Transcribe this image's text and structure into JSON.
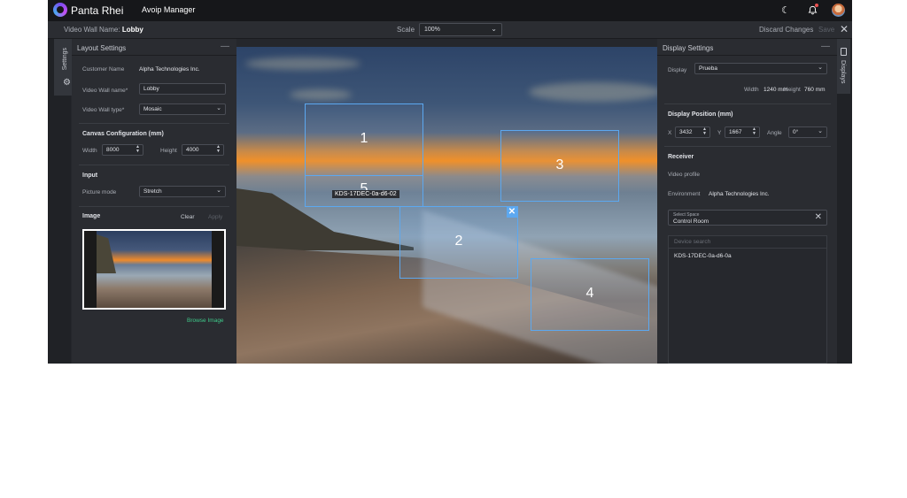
{
  "topbar": {
    "brand": "Panta Rhei",
    "app_name": "Avoip Manager",
    "icons": [
      "moon-icon",
      "bell-icon",
      "avatar"
    ]
  },
  "subbar": {
    "wall_name_label": "Video Wall Name:",
    "wall_name": "Lobby",
    "scale_label": "Scale",
    "scale_value": "100%",
    "discard_label": "Discard Changes",
    "save_label": "Save"
  },
  "left_rail": {
    "tab_label": "Settings"
  },
  "layout_settings": {
    "title": "Layout Settings",
    "customer_name_label": "Customer Name",
    "customer_name": "Alpha Technologies Inc.",
    "wall_name_label": "Video Wall name*",
    "wall_name_value": "Lobby",
    "wall_type_label": "Video Wall type*",
    "wall_type_value": "Mosaic",
    "canvas_section": "Canvas Configuration (mm)",
    "width_label": "Width",
    "width_value": "8000",
    "height_label": "Height",
    "height_value": "4000",
    "input_section": "Input",
    "picture_mode_label": "Picture mode",
    "picture_mode_value": "Stretch",
    "image_section": "Image",
    "clear_label": "Clear",
    "apply_label": "Apply",
    "browse_label": "Browse Image"
  },
  "canvas": {
    "tiles": [
      "1",
      "2",
      "3",
      "4",
      "5"
    ],
    "device_label": "KDS-17DEC-0a-d6-02"
  },
  "display_settings": {
    "title": "Display Settings",
    "display_label": "Display",
    "display_value": "Prueba",
    "width_label": "Width",
    "width_value": "1240 mm",
    "height_label": "Height",
    "height_value": "760 mm",
    "position_section": "Display Position (mm)",
    "x_label": "X",
    "x_value": "3432",
    "y_label": "Y",
    "y_value": "1667",
    "angle_label": "Angle",
    "angle_value": "0°",
    "receiver_section": "Receiver",
    "video_profile_label": "Video profile",
    "environment_label": "Environment",
    "environment_value": "Alpha Technologies Inc.",
    "space_label": "Select Space",
    "space_value": "Control Room",
    "device_search_placeholder": "Device search",
    "devices": [
      "KDS-17DEC-0a-d6-0a"
    ]
  },
  "right_rail": {
    "tab_label": "Displays"
  }
}
